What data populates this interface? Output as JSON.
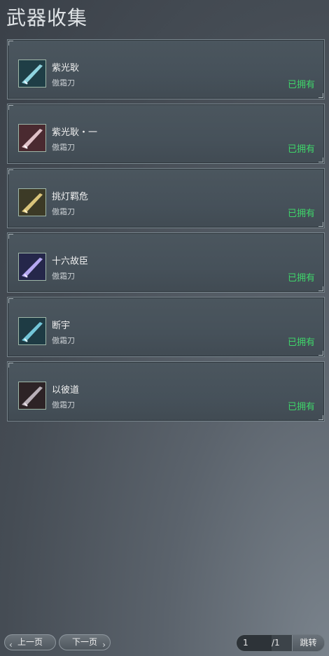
{
  "header": {
    "title": "武器收集"
  },
  "items": [
    {
      "name": "紫光耿",
      "class": "傲霜刀",
      "status": "已拥有",
      "icon": "sword-icon",
      "color": "#2b6f78"
    },
    {
      "name": "紫光耿・一",
      "class": "傲霜刀",
      "status": "已拥有",
      "icon": "sword-icon",
      "color": "#6b3a43"
    },
    {
      "name": "挑灯羁危",
      "class": "傲霜刀",
      "status": "已拥有",
      "icon": "sword-icon",
      "color": "#5b5a3a"
    },
    {
      "name": "十六故臣",
      "class": "傲霜刀",
      "status": "已拥有",
      "icon": "sword-icon",
      "color": "#3b3f7a"
    },
    {
      "name": "断宇",
      "class": "傲霜刀",
      "status": "已拥有",
      "icon": "sword-icon",
      "color": "#2b5c6b"
    },
    {
      "name": "以彼道",
      "class": "傲霜刀",
      "status": "已拥有",
      "icon": "sword-icon",
      "color": "#4a3a3a"
    }
  ],
  "pager": {
    "prev_label": "上一页",
    "next_label": "下一页",
    "current_page": "1",
    "total_label": "/1",
    "jump_label": "跳转"
  },
  "colors": {
    "owned": "#3fd66a"
  }
}
